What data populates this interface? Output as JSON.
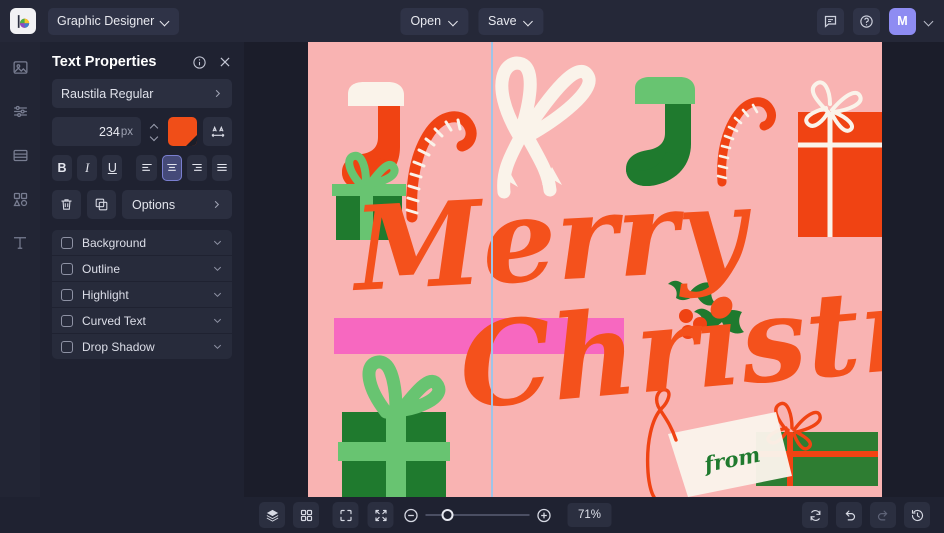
{
  "app": {
    "logo_icon": "color-wheel-logo",
    "doc_type": "Graphic Designer"
  },
  "topbar": {
    "open_label": "Open",
    "save_label": "Save",
    "comment_icon": "comment-icon",
    "help_icon": "help-circle-icon",
    "avatar_initial": "M"
  },
  "rail": {
    "items": [
      {
        "icon": "image-icon",
        "name": "image"
      },
      {
        "icon": "adjust-sliders-icon",
        "name": "adjust"
      },
      {
        "icon": "layout-icon",
        "name": "layout"
      },
      {
        "icon": "elements-grid-icon",
        "name": "elements"
      },
      {
        "icon": "text-t-icon",
        "name": "text"
      }
    ]
  },
  "panel": {
    "title": "Text Properties",
    "info_icon": "info-circle-icon",
    "close_icon": "close-x-icon",
    "font_name": "Raustila Regular",
    "font_size": "234",
    "font_size_unit": "px",
    "color_swatch": "#F04E18",
    "letter_spacing_icon": "letter-spacing-icon",
    "format": {
      "bold": "B",
      "italic": "I",
      "underline": "U",
      "align_left": "align-left-icon",
      "align_center": "align-center-icon",
      "align_right": "align-right-icon",
      "align_justify": "align-justify-icon",
      "selected_align": "align-center-icon"
    },
    "delete_icon": "trash-icon",
    "duplicate_icon": "duplicate-icon",
    "options_label": "Options",
    "toggles": [
      {
        "label": "Background",
        "checked": false
      },
      {
        "label": "Outline",
        "checked": false
      },
      {
        "label": "Highlight",
        "checked": false
      },
      {
        "label": "Curved Text",
        "checked": false
      },
      {
        "label": "Drop Shadow",
        "checked": false
      }
    ]
  },
  "canvas": {
    "background_color": "#F9B3B2",
    "text_line_1": "Merry",
    "text_line_2": "Christmas",
    "text_color": "#F4511C",
    "highlight_color": "#F768C0",
    "guide_color": "#9FC4E8",
    "tag_text": "from",
    "artwork": [
      {
        "name": "red-stocking",
        "color": "#F04313"
      },
      {
        "name": "candy-cane-left",
        "color": "#F04313"
      },
      {
        "name": "white-bow",
        "color": "#FAF3EA"
      },
      {
        "name": "green-stocking",
        "color": "#1F7A2E"
      },
      {
        "name": "candy-cane-right",
        "color": "#F04313"
      },
      {
        "name": "orange-gift-tall",
        "color": "#F04313"
      },
      {
        "name": "green-gift-small",
        "color": "#1F7A2E"
      },
      {
        "name": "holly-berries",
        "color": "#1F7A2E"
      },
      {
        "name": "green-gift-stack",
        "color": "#1F7A2E"
      },
      {
        "name": "pink-box",
        "color": "#F768C0"
      },
      {
        "name": "green-gift-wide",
        "color": "#2E7D32"
      },
      {
        "name": "gift-tag",
        "color": "#FAF3EA"
      }
    ]
  },
  "bottombar": {
    "layers_icon": "layers-icon",
    "grid_icon": "grid-icon",
    "fullscreen_icon": "fullscreen-icon",
    "fit_screen_icon": "fit-to-screen-icon",
    "zoom_out_icon": "zoom-out-icon",
    "zoom_in_icon": "zoom-in-icon",
    "zoom_level": "71%",
    "reset_icon": "reset-icon",
    "undo_icon": "undo-icon",
    "redo_icon": "redo-icon",
    "history_icon": "history-icon"
  }
}
